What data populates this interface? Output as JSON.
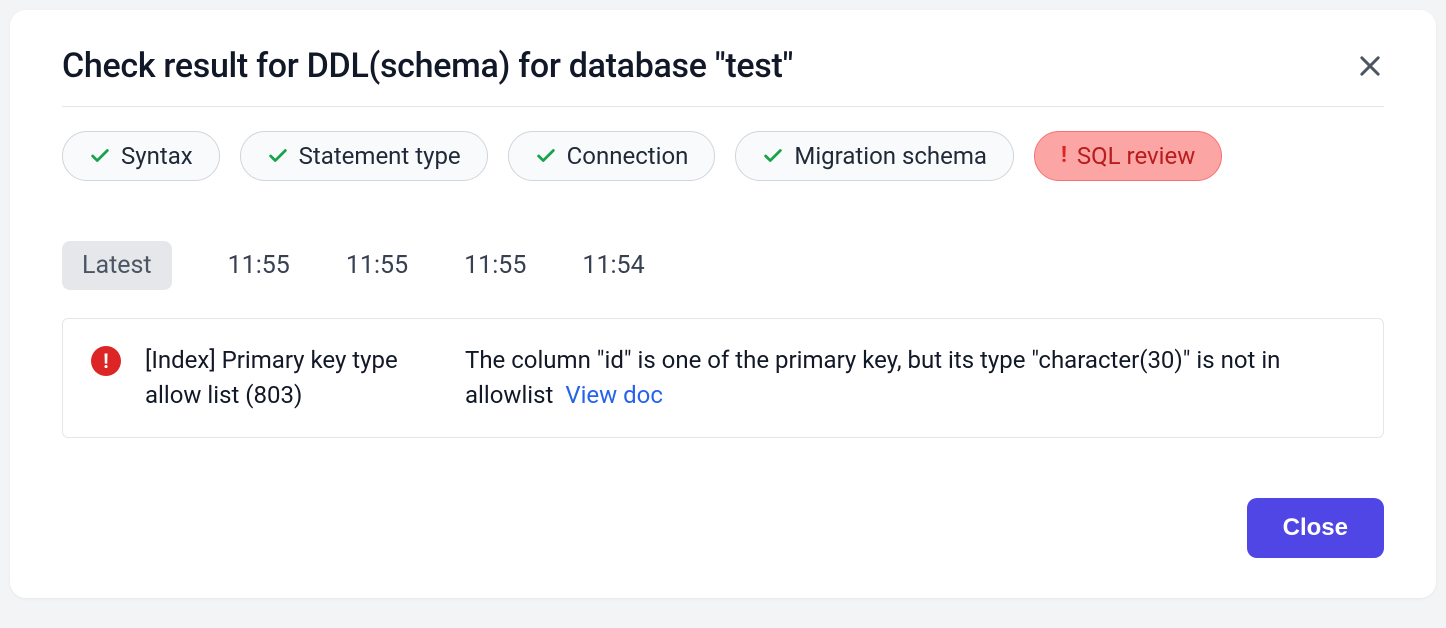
{
  "header": {
    "title": "Check result for DDL(schema) for database \"test\""
  },
  "checks": [
    {
      "label": "Syntax",
      "status": "ok"
    },
    {
      "label": "Statement type",
      "status": "ok"
    },
    {
      "label": "Connection",
      "status": "ok"
    },
    {
      "label": "Migration schema",
      "status": "ok"
    },
    {
      "label": "SQL review",
      "status": "error"
    }
  ],
  "tabs": [
    {
      "label": "Latest",
      "active": true
    },
    {
      "label": "11:55",
      "active": false
    },
    {
      "label": "11:55",
      "active": false
    },
    {
      "label": "11:55",
      "active": false
    },
    {
      "label": "11:54",
      "active": false
    }
  ],
  "result": {
    "severity": "error",
    "title": "[Index] Primary key type allow list (803)",
    "message": "The column \"id\" is one of the primary key, but its type \"character(30)\" is not in allowlist",
    "doc_link_label": "View doc"
  },
  "footer": {
    "close_label": "Close"
  }
}
